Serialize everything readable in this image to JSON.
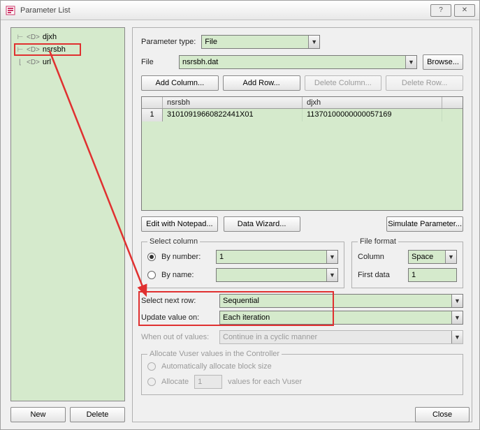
{
  "window": {
    "title": "Parameter List"
  },
  "tree": {
    "items": [
      {
        "label": "djxh"
      },
      {
        "label": "nsrsbh"
      },
      {
        "label": "url"
      }
    ],
    "highlight_index": 1
  },
  "left_buttons": {
    "new": "New",
    "delete": "Delete"
  },
  "param_type": {
    "label": "Parameter type:",
    "value": "File"
  },
  "file": {
    "label": "File",
    "value": "nsrsbh.dat",
    "browse": "Browse..."
  },
  "grid_buttons": {
    "add_column": "Add Column...",
    "add_row": "Add Row...",
    "delete_column": "Delete Column...",
    "delete_row": "Delete Row..."
  },
  "grid": {
    "columns": [
      "nsrsbh",
      "djxh"
    ],
    "rows": [
      {
        "num": "1",
        "cells": [
          "31010919660822441X01",
          "11370100000000057169"
        ]
      }
    ]
  },
  "mid_buttons": {
    "edit_notepad": "Edit with Notepad...",
    "data_wizard": "Data Wizard...",
    "simulate": "Simulate Parameter..."
  },
  "select_column": {
    "legend": "Select column",
    "by_number_label": "By number:",
    "by_number_value": "1",
    "by_name_label": "By name:",
    "by_name_value": ""
  },
  "file_format": {
    "legend": "File format",
    "column_label": "Column",
    "column_value": "Space",
    "first_data_label": "First data",
    "first_data_value": "1"
  },
  "next_row": {
    "label": "Select next row:",
    "value": "Sequential"
  },
  "update_on": {
    "label": "Update value on:",
    "value": "Each iteration"
  },
  "out_of_values": {
    "label": "When out of values:",
    "value": "Continue in a cyclic manner"
  },
  "vuser_alloc": {
    "legend": "Allocate Vuser values in the Controller",
    "auto_label": "Automatically allocate block size",
    "allocate_label": "Allocate",
    "allocate_value": "1",
    "suffix": "values for each Vuser"
  },
  "close": "Close",
  "colors": {
    "accent": "#d5eacc",
    "highlight": "#e03030"
  }
}
